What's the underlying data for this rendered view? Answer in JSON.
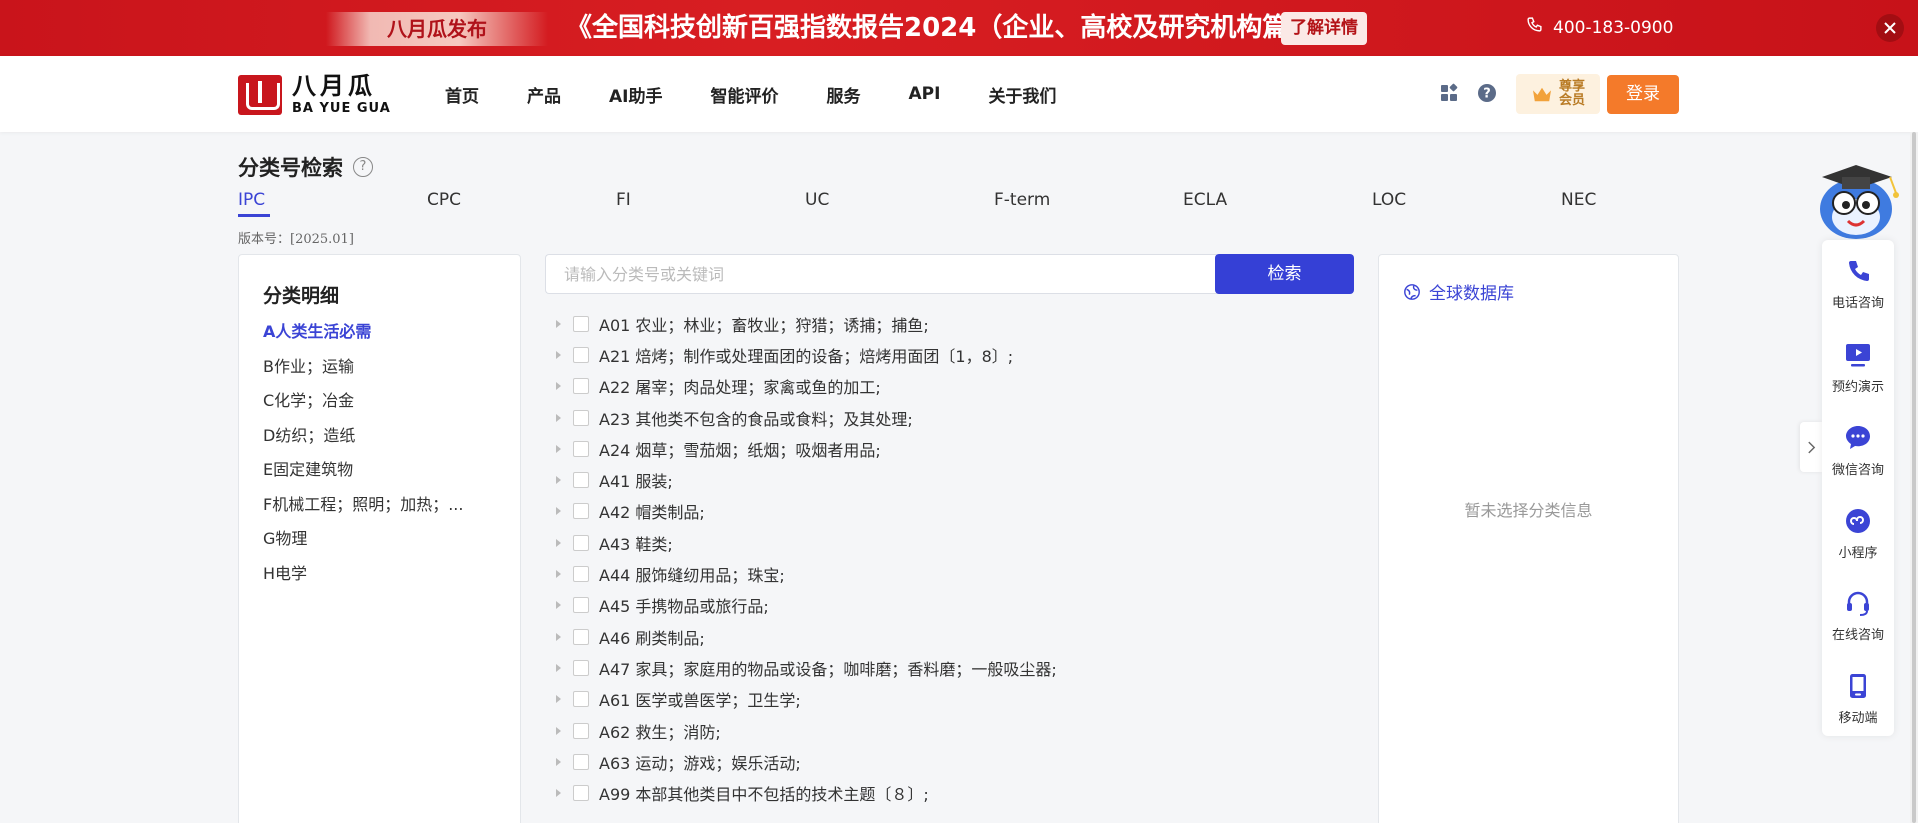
{
  "banner": {
    "tag": "八月瓜发布",
    "title": "《全国科技创新百强指数报告2024（企业、高校及研究机构篇）》",
    "cta": "了解详情",
    "phone": "400-183-0900"
  },
  "header": {
    "logo_cn": "八月瓜",
    "logo_en": "BA YUE GUA",
    "nav": [
      "首页",
      "产品",
      "AI助手",
      "智能评价",
      "服务",
      "API",
      "关于我们"
    ],
    "vip_line1": "尊享",
    "vip_line2": "会员",
    "login": "登录"
  },
  "page": {
    "title": "分类号检索",
    "tabs": [
      "IPC",
      "CPC",
      "FI",
      "UC",
      "F-term",
      "ECLA",
      "LOC",
      "NEC"
    ],
    "version": "版本号：[2025.01]"
  },
  "left_panel": {
    "title": "分类明细",
    "items": [
      "A人类生活必需",
      "B作业；运输",
      "C化学；冶金",
      "D纺织；造纸",
      "E固定建筑物",
      "F机械工程；照明；加热；...",
      "G物理",
      "H电学"
    ]
  },
  "search": {
    "placeholder": "请输入分类号或关键词",
    "button": "检索"
  },
  "classes": [
    "A01 农业；林业；畜牧业；狩猎；诱捕；捕鱼;",
    "A21 焙烤；制作或处理面团的设备；焙烤用面团〔1，8〕;",
    "A22 屠宰；肉品处理；家禽或鱼的加工;",
    "A23 其他类不包含的食品或食料；及其处理;",
    "A24 烟草；雪茄烟；纸烟；吸烟者用品;",
    "A41 服装;",
    "A42 帽类制品;",
    "A43 鞋类;",
    "A44 服饰缝纫用品；珠宝;",
    "A45 手携物品或旅行品;",
    "A46 刷类制品;",
    "A47 家具；家庭用的物品或设备；咖啡磨；香料磨；一般吸尘器;",
    "A61 医学或兽医学；卫生学;",
    "A62 救生；消防;",
    "A63 运动；游戏；娱乐活动;",
    "A99 本部其他类目中不包括的技术主题〔８〕;"
  ],
  "right_panel": {
    "title": "全球数据库",
    "empty": "暂未选择分类信息"
  },
  "side_bar": {
    "items": [
      {
        "label": "电话咨询",
        "icon": "phone-icon"
      },
      {
        "label": "预约演示",
        "icon": "presentation-icon"
      },
      {
        "label": "微信咨询",
        "icon": "chat-bubble-icon"
      },
      {
        "label": "小程序",
        "icon": "mini-program-icon"
      },
      {
        "label": "在线咨询",
        "icon": "headset-icon"
      },
      {
        "label": "移动端",
        "icon": "mobile-icon"
      }
    ]
  },
  "colors": {
    "accent": "#3b44d5",
    "banner_red": "#d81e22",
    "login_orange": "#f47a2a"
  }
}
